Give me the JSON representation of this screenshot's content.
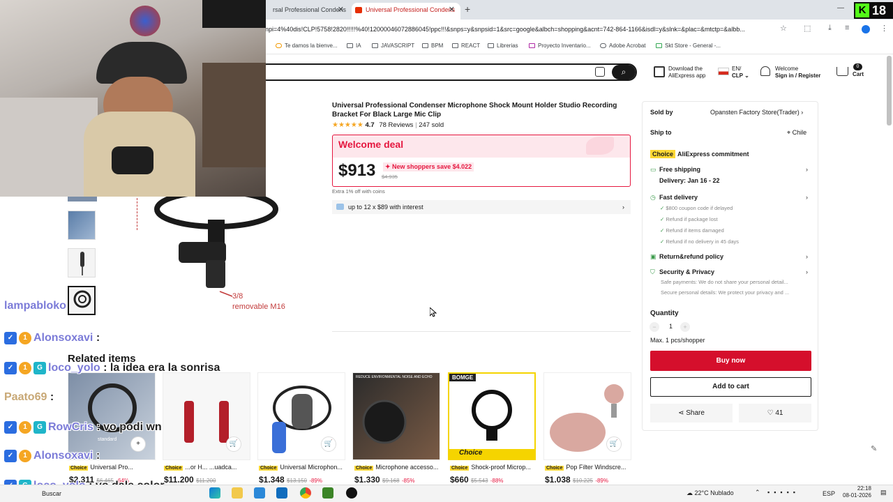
{
  "browser": {
    "tabs": [
      "rsal Professional Condens",
      "Universal Professional Condens"
    ],
    "url": "npi=4%40dis!CLP!5758!2820!!!!!%40!12000046072886045!ppc!!!&snps=y&snpsid=1&src=google&albch=shopping&acnt=742-864-1166&isdl=y&slnk=&plac=&mtctp=&albb...",
    "bookmarks": [
      "Te damos la bienve...",
      "IA",
      "JAVASCRIPT",
      "BPM",
      "REACT",
      "Librerias",
      "Proyecto Inventario...",
      "Adobe Acrobat",
      "Skt Store - General -..."
    ]
  },
  "stream": {
    "channel_badge": "K",
    "viewer_count": "18"
  },
  "header": {
    "app_download": [
      "Download the",
      "AliExpress app"
    ],
    "lang": "EN/",
    "currency": "CLP",
    "welcome": "Welcome",
    "signin": "Sign in / Register",
    "cart_count": "0",
    "cart_label": "Cart"
  },
  "product": {
    "title": "Universal Professional Condenser Microphone Shock Mount Holder Studio Recording Bracket For Black Large Mic Clip",
    "rating": "4.7",
    "reviews": "78 Reviews",
    "sold": "247 sold",
    "deal_title": "Welcome deal",
    "price": "$913",
    "save_text": "New shoppers save $4.022",
    "old_price": "$4.935",
    "coins": "Extra 1% off with coins",
    "installment": "up to 12 x $89 with interest",
    "image_caption_1": "3/8",
    "image_caption_2": "removable M16"
  },
  "panel": {
    "sold_by_label": "Sold by",
    "store": "Opansten Factory Store(Trader)",
    "ship_to_label": "Ship to",
    "ship_to": "Chile",
    "choice_tag": "Choice",
    "commitment": "AliExpress commitment",
    "free_shipping": "Free shipping",
    "delivery": "Delivery: Jan 16 - 22",
    "fast_delivery": "Fast delivery",
    "fast_items": [
      "$800 coupon code if delayed",
      "Refund if package lost",
      "Refund if items damaged",
      "Refund if no delivery in 45 days"
    ],
    "return_policy": "Return&refund policy",
    "security": "Security & Privacy",
    "security_items": [
      "Safe payments: We do not share your personal detail...",
      "Secure personal details: We protect your privacy and ..."
    ],
    "quantity_label": "Quantity",
    "quantity": "1",
    "max": "Max. 1 pcs/shopper",
    "buy_now": "Buy now",
    "add_to_cart": "Add to cart",
    "share": "Share",
    "wishlist": "41"
  },
  "related": {
    "title": "Related items",
    "items": [
      {
        "tag": "Choice",
        "name": "Universal Pro...",
        "price": "$2.311",
        "old": "$6.465",
        "disc": "-64%"
      },
      {
        "tag": "Choice",
        "name": "...or H... ...uadca...",
        "price": "$11.200",
        "old": "$11.200",
        "disc": ""
      },
      {
        "tag": "Choice",
        "name": "Universal Microphon...",
        "price": "$1.348",
        "old": "$13.150",
        "disc": "-89%"
      },
      {
        "tag": "Choice",
        "name": "Microphone accesso...",
        "price": "$1.330",
        "old": "$9.168",
        "disc": "-85%"
      },
      {
        "tag": "Choice",
        "name": "Shock-proof Microp...",
        "price": "$660",
        "old": "$5.543",
        "disc": "-88%"
      },
      {
        "tag": "Choice",
        "name": "Pop Filter Windscre...",
        "price": "$1.038",
        "old": "$10.225",
        "disc": "-89%"
      }
    ],
    "card3_banner": "REDUCE ENVIRONMENTAL NOISE AND ECHO",
    "card4_brand": "BOMGE",
    "card4_badge": "Choice",
    "card1_label": "standard"
  },
  "chat": [
    {
      "user": "lampabloko",
      "msg": ""
    },
    {
      "user": "Alonsoxavi",
      "msg": ":"
    },
    {
      "user": "loco_yolo",
      "msg": ": la idea era la sonrisa"
    },
    {
      "user": "Paato69",
      "msg": ":"
    },
    {
      "user": "RowCris",
      "msg": ": vo podi wn"
    },
    {
      "user": "Alonsoxavi",
      "msg": ":"
    },
    {
      "user": "loco_yolo",
      "msg": ": vo dale color"
    }
  ],
  "taskbar": {
    "search": "Buscar",
    "weather": "22°C  Nublado",
    "lang": "ESP",
    "time": "22:18",
    "date": "08-01-2026"
  },
  "colors": {
    "accent": "#e5173f",
    "buy": "#d50f2c",
    "choice": "#fdd835",
    "kick": "#53fc18"
  }
}
